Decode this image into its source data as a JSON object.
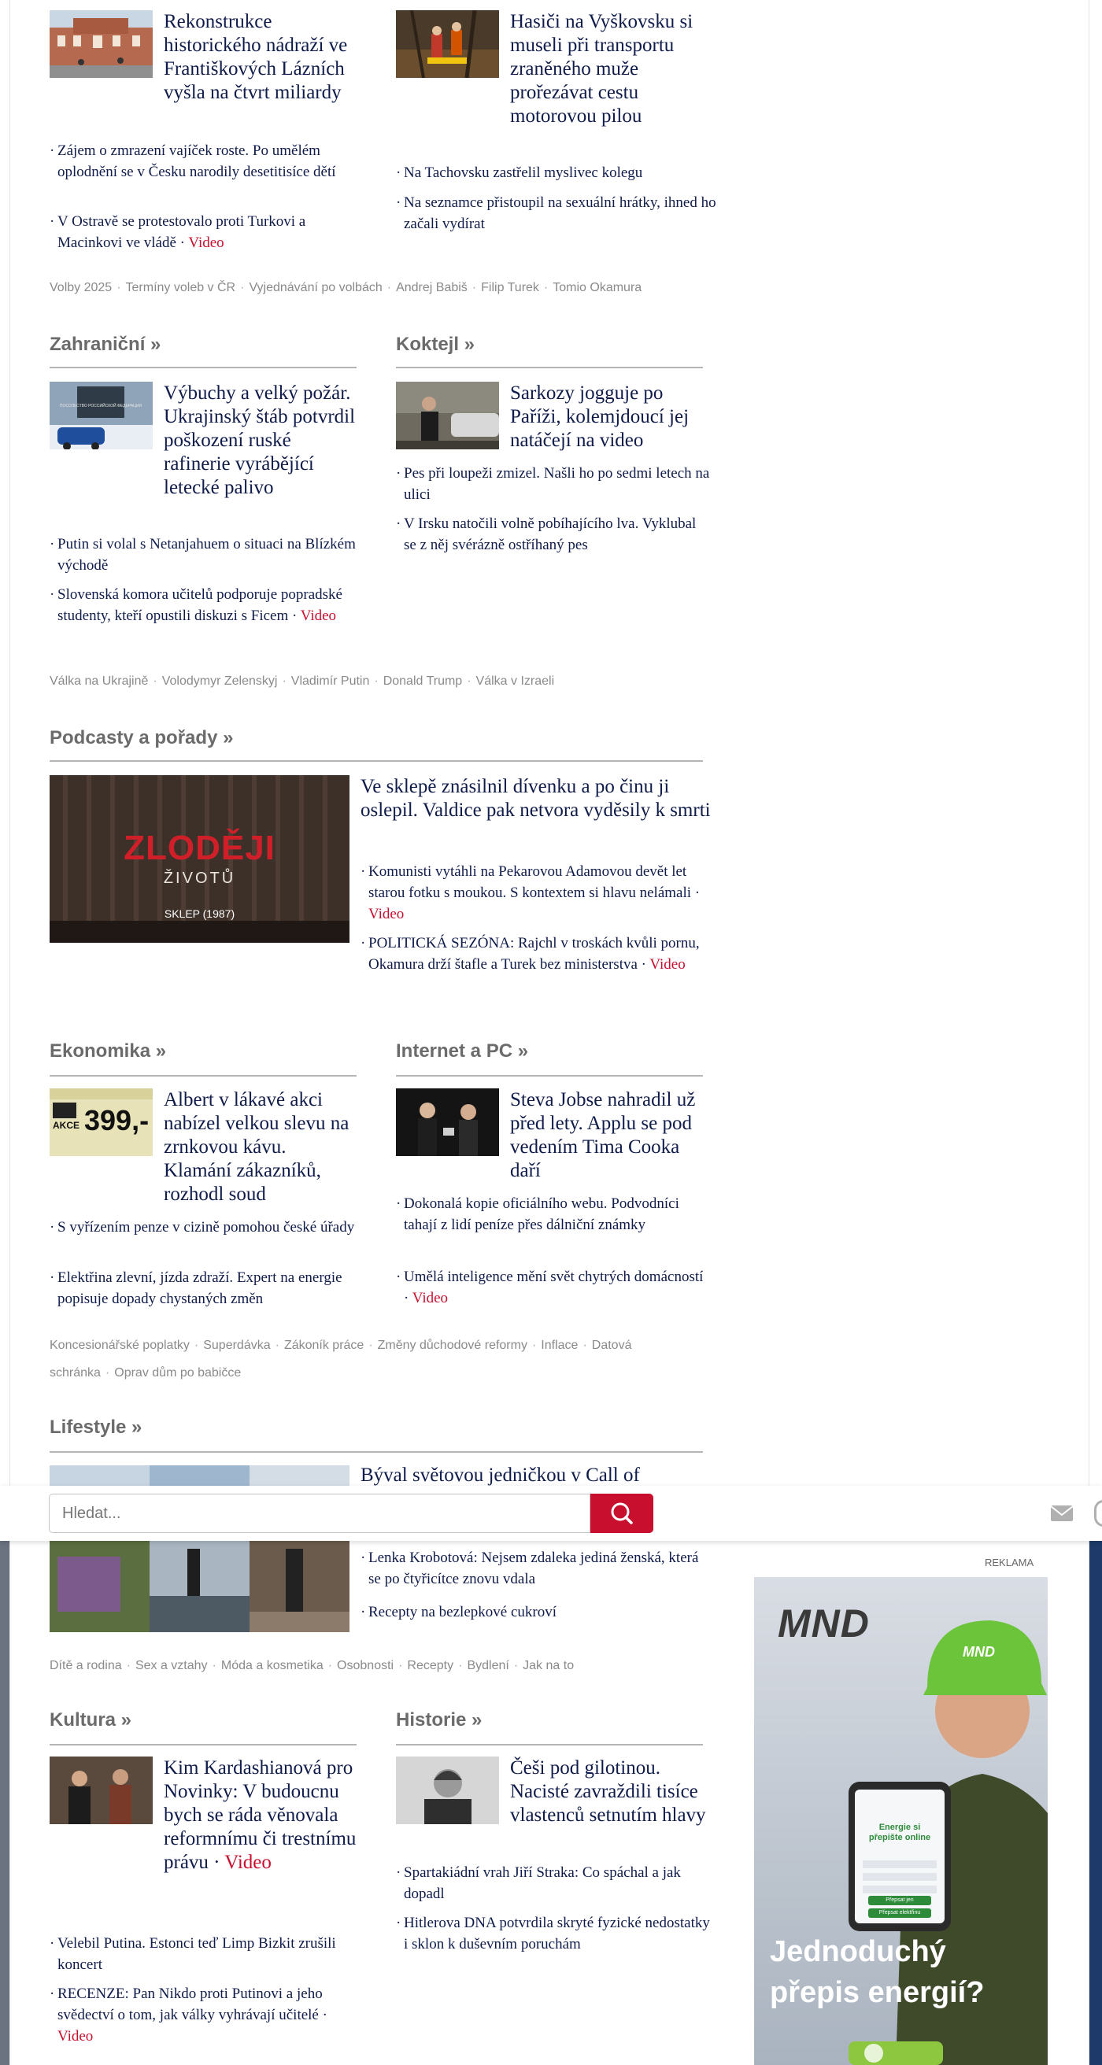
{
  "top_left": {
    "headline": "Rekonstrukce historického nádraží ve Františkových Lázních vyšla na čtvrt miliardy",
    "items": [
      {
        "text": "Zájem o zmrazení vajíček roste. Po umělém oplodnění se v Česku narodily desetitisíce dětí"
      },
      {
        "text": "V Ostravě se protestovalo proti Turkovi a Macinkovi ve vládě",
        "video": "Video"
      }
    ]
  },
  "top_right": {
    "headline": "Hasiči na Vyškovsku si museli při transportu zraněného muže prořezávat cestu motorovou pilou",
    "items": [
      {
        "text": "Na Tachovsku zastřelil myslivec kolegu"
      },
      {
        "text": "Na seznamce přistoupil na sexuální hrátky, ihned ho začali vydírat"
      }
    ]
  },
  "tags_1": [
    "Volby 2025",
    "Termíny voleb v ČR",
    "Vyjednávání po volbách",
    "Andrej Babiš",
    "Filip Turek",
    "Tomio Okamura"
  ],
  "zahranicni": {
    "title": "Zahraniční »",
    "headline": "Výbuchy a velký požár. Ukrajinský štáb potvrdil poškození ruské rafinerie vyrábějící letecké palivo",
    "thumb_sign": "ПОСОЛЬСТВО РОССИЙСКОЙ ФЕДЕРАЦИИ",
    "items": [
      {
        "text": "Putin si volal s Netanjahuem o situaci na Blízkém východě"
      },
      {
        "text": "Slovenská komora učitelů podporuje popradské studenty, kteří opustili diskuzi s Ficem",
        "video": "Video"
      }
    ]
  },
  "koktejl": {
    "title": "Koktejl »",
    "headline": "Sarkozy jogguje po Paříži, kolemjdoucí jej natáčejí na video",
    "items": [
      {
        "text": "Pes při loupeži zmizel. Našli ho po sedmi letech na ulici"
      },
      {
        "text": "V Irsku natočili volně pobíhajícího lva. Vyklubal se z něj svérázně ostříhaný pes"
      }
    ]
  },
  "tags_2": [
    "Válka na Ukrajině",
    "Volodymyr Zelenskyj",
    "Vladimír Putin",
    "Donald Trump",
    "Válka v Izraeli"
  ],
  "podcasty": {
    "title": "Podcasty a pořady »",
    "thumb_title": "ZLODĚJI",
    "thumb_subtitle": "ŽIVOTŮ",
    "thumb_caption": "SKLEP (1987)",
    "headline": "Ve sklepě znásilnil dívenku a po činu ji oslepil. Valdice pak netvora vyděsily k smrti",
    "items": [
      {
        "text": "Komunisti vytáhli na Pekarovou Adamovou devět let starou fotku s moukou. S kontextem si hlavu nelámali",
        "video": "Video"
      },
      {
        "text": "POLITICKÁ SEZÓNA: Rajchl v troskách kvůli pornu, Okamura drží štafle a Turek bez ministerstva",
        "video": "Video"
      }
    ]
  },
  "ekonomika": {
    "title": "Ekonomika »",
    "headline": "Albert v lákavé akci nabízel velkou slevu na zrnkovou kávu. Klamání zákazníků, rozhodl soud",
    "thumb_price": "399,-",
    "thumb_akce": "AKCE",
    "items": [
      {
        "text": "S vyřízením penze v cizině pomohou české úřady"
      },
      {
        "text": "Elektřina zlevní, jízda zdraží. Expert na energie popisuje dopady chystaných změn"
      }
    ]
  },
  "internet": {
    "title": "Internet a PC »",
    "headline": "Steva Jobse nahradil už před lety. Applu se pod vedením Tima Cooka daří",
    "items": [
      {
        "text": "Dokonalá kopie oficiálního webu. Podvodníci tahají z lidí peníze přes dálniční známky"
      },
      {
        "text": "Umělá inteligence mění svět chytrých domácností",
        "video": "Video"
      }
    ]
  },
  "tags_3": [
    "Koncesionářské poplatky",
    "Superdávka",
    "Zákoník práce",
    "Změny důchodové reformy",
    "Inflace",
    "Datová schránka",
    "Oprav dům po babičce"
  ],
  "lifestyle": {
    "title": "Lifestyle »",
    "headline": "Býval světovou jedničkou v Call of",
    "items": [
      {
        "text": "Lenka Krobotová: Nejsem zdaleka jediná ženská, která se po čtyřicítce znovu vdala"
      },
      {
        "text": "Recepty na bezlepkové cukroví"
      }
    ]
  },
  "tags_4": [
    "Dítě a rodina",
    "Sex a vztahy",
    "Móda a kosmetika",
    "Osobnosti",
    "Recepty",
    "Bydlení",
    "Jak na to"
  ],
  "kultura": {
    "title": "Kultura »",
    "headline": "Kim Kardashianová pro Novinky: V budoucnu bych se ráda věnovala reformnímu či trestnímu právu",
    "headline_video": "Video",
    "items": [
      {
        "text": "Velebil Putina. Estonci teď Limp Bizkit zrušili koncert"
      },
      {
        "text": "RECENZE: Pan Nikdo proti Putinovi a jeho svědectví o tom, jak války vyhrávají učitelé",
        "video": "Video"
      }
    ]
  },
  "historie": {
    "title": "Historie »",
    "headline": "Češi pod gilotinou. Nacisté zavraždili tisíce vlastenců setnutím hlavy",
    "items": [
      {
        "text": "Spartakiádní vrah Jiří Straka: Co spáchal a jak dopadl"
      },
      {
        "text": "Hitlerova DNA potvrdila skryté fyzické nedostatky i sklon k duševním poruchám"
      }
    ]
  },
  "search": {
    "placeholder": "Hledat..."
  },
  "ad": {
    "label": "REKLAMA",
    "logo": "MND",
    "helmet_logo": "MND",
    "tablet_title": "Energie si přepište online",
    "tablet_button_1": "Přepsat jen",
    "tablet_button_2": "Přepsat elektřinu",
    "headline": "Jednoduchý přepis energií?"
  },
  "colors": {
    "headline": "#0f1b4a",
    "video": "#c8102e",
    "tags": "#8a8a8a",
    "section_title": "#6b6b6b",
    "search_button": "#c8102e"
  },
  "icons": [
    "search-icon",
    "mail-icon"
  ]
}
